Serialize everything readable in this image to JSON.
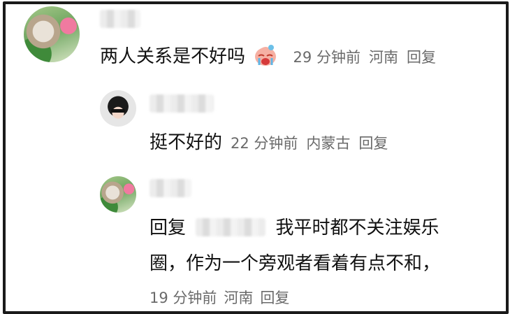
{
  "comments": [
    {
      "text": "两人关系是不好吗",
      "emoji": "crying-face",
      "time": "29 分钟前",
      "location": "河南",
      "reply_label": "回复"
    },
    {
      "text": "挺不好的",
      "time": "22 分钟前",
      "location": "内蒙古",
      "reply_label": "回复"
    },
    {
      "reply_prefix": "回复",
      "line1": "我平时都不关注娱乐",
      "line2": "圈，作为一个旁观者看着有点不和，",
      "time": "19 分钟前",
      "location": "河南",
      "reply_label": "回复"
    }
  ],
  "colors": {
    "text": "#111111",
    "meta": "#6a6a6a",
    "border": "#1a1a1a"
  }
}
